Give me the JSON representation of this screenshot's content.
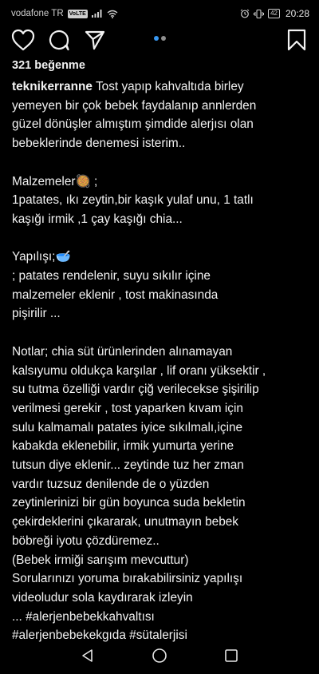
{
  "status_bar": {
    "carrier": "vodafone TR",
    "volte": "VoLTE",
    "battery": "42",
    "time": "20:28"
  },
  "post": {
    "likes": "321 beğenme",
    "username": "teknikerranne",
    "caption_first": " Tost yapıp kahvaltıda birley",
    "caption_lines": [
      "yemeyen bir çok bebek faydalanıp annlerden",
      "güzel dönüşler almıştım şimdide alerjısı olan",
      "bebeklerinde denemesi isterim..",
      "",
      "Malzemeler🥘 ;",
      "1patates, ıkı zeytin,bir kaşık yulaf unu, 1 tatlı",
      "kaşığı irmik ,1 çay kaşığı chia...",
      "",
      "Yapılışı;🥣",
      "; patates rendelenir, suyu sıkılır içine",
      "malzemeler eklenir , tost makinasında",
      "pişirilir ...",
      "",
      "Notlar; chia süt ürünlerinden alınamayan",
      "kalsıyumu oldukça karşılar , lif oranı yüksektir ,",
      "su tutma  özelliği vardır çiğ verilecekse şişirilip",
      "verilmesi gerekir , tost yaparken kıvam için",
      "sulu kalmamalı patates iyice sıkılmalı,içine",
      "kabakda eklenebilir,  irmik yumurta yerine",
      "tutsun diye eklenir... zeytinde tuz her zman",
      "vardır tuzsuz denilende de o yüzden",
      "zeytinlerinizi bir gün boyunca suda bekletin",
      "çekirdeklerini çıkararak, unutmayın bebek",
      "böbreği  iyotu çözdüremez..",
      "(Bebek irmiği sarışım mevcuttur)",
      "Sorularınızı yoruma bırakabilirsiniz yapılışı",
      "videoludur sola kaydırarak izleyin",
      "... #alerjenbebekkahvaltısı",
      "#alerjenbebekekgıda  #sütalerjisi"
    ]
  },
  "carousel": {
    "active_color": "#3897f0",
    "inactive_color": "#8e8e8e"
  },
  "icons": [
    "heart-icon",
    "comment-icon",
    "share-icon",
    "bookmark-icon",
    "back-nav-icon",
    "home-nav-icon",
    "recents-nav-icon"
  ]
}
